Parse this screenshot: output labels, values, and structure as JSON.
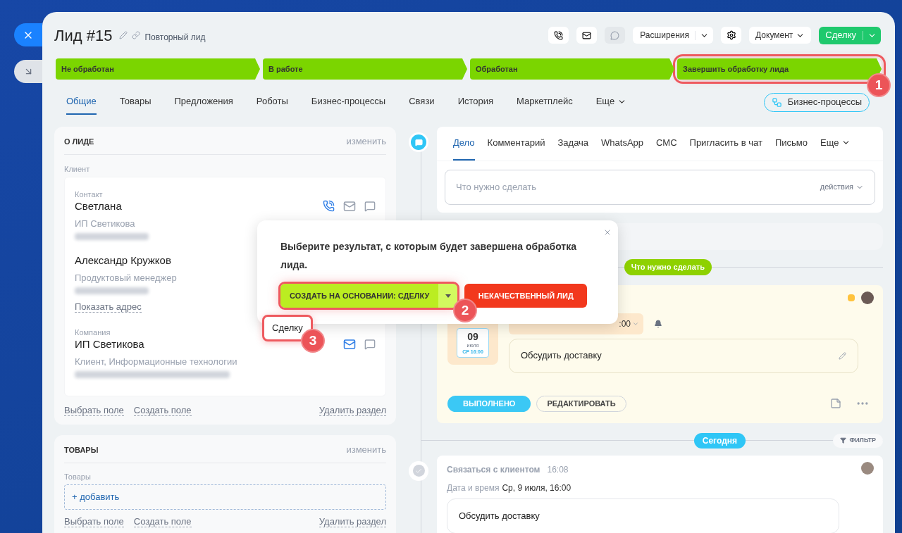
{
  "header": {
    "title": "Лид #15",
    "subtitle": "Повторный лид",
    "extensions": "Расширения",
    "document": "Документ",
    "primary": "Сделку"
  },
  "stages": [
    {
      "label": "Не обработан",
      "highlighted": false
    },
    {
      "label": "В работе",
      "highlighted": false
    },
    {
      "label": "Обработан",
      "highlighted": false
    },
    {
      "label": "Завершить обработку лида",
      "highlighted": true
    }
  ],
  "tabs": [
    {
      "label": "Общие",
      "selected": true
    },
    {
      "label": "Товары",
      "selected": false
    },
    {
      "label": "Предложения",
      "selected": false
    },
    {
      "label": "Роботы",
      "selected": false
    },
    {
      "label": "Бизнес-процессы",
      "selected": false
    },
    {
      "label": "Связи",
      "selected": false
    },
    {
      "label": "История",
      "selected": false
    },
    {
      "label": "Маркетплейс",
      "selected": false
    },
    {
      "label": "Еще",
      "selected": false,
      "kind": "more"
    }
  ],
  "bp_button": "Бизнес-процессы",
  "about": {
    "title": "О ЛИДЕ",
    "edit": "изменить",
    "field_label": "Клиент",
    "entries": [
      {
        "kind": "contact",
        "caption": "Контакт",
        "name": "Светлана",
        "detail": "ИП Светикова"
      },
      {
        "kind": "person",
        "name": "Александр Кружков",
        "detail": "Продуктовый менеджер",
        "link": "Показать адрес"
      },
      {
        "kind": "company",
        "caption": "Компания",
        "name": "ИП Светикова",
        "detail": "Клиент, Информационные технологии"
      }
    ],
    "links": [
      "Выбрать поле",
      "Создать поле",
      "Удалить раздел"
    ]
  },
  "goods": {
    "title": "ТОВАРЫ",
    "edit": "изменить",
    "field_label": "Товары",
    "add": "+ добавить",
    "links": [
      "Выбрать поле",
      "Создать поле",
      "Удалить раздел"
    ]
  },
  "composer": {
    "tabs": [
      {
        "label": "Дело",
        "selected": true
      },
      {
        "label": "Комментарий",
        "selected": false
      },
      {
        "label": "Задача",
        "selected": false
      },
      {
        "label": "WhatsApp",
        "selected": false
      },
      {
        "label": "СМС",
        "selected": false
      },
      {
        "label": "Пригласить в чат",
        "selected": false
      },
      {
        "label": "Письмо",
        "selected": false
      },
      {
        "label": "Еще",
        "selected": false,
        "kind": "more"
      }
    ],
    "placeholder": "Что нужно сделать",
    "actions": "действия"
  },
  "todo_pill": "Что нужно сделать",
  "activity": {
    "day": "09",
    "month": "июля",
    "time": "СР 16:00",
    "chip": ":00",
    "text": "Обсудить доставку",
    "done": "ВЫПОЛНЕНО",
    "edit": "РЕДАКТИРОВАТЬ"
  },
  "today": "Сегодня",
  "filter": "ФИЛЬТР",
  "history": {
    "title": "Связаться с клиентом",
    "time": "16:08",
    "label": "Дата и время",
    "value": "Ср, 9 июля, 16:00",
    "text": "Обсудить доставку"
  },
  "popup": {
    "text": "Выберите результат, с которым будет завершена обработка лида.",
    "primary": "СОЗДАТЬ НА ОСНОВАНИИ: СДЕЛКУ",
    "primary_highlighted": true,
    "secondary": "НЕКАЧЕСТВЕННЫЙ ЛИД",
    "menu_item": "Сделку",
    "menu_highlighted": true
  },
  "callouts": [
    "1",
    "2",
    "3"
  ]
}
